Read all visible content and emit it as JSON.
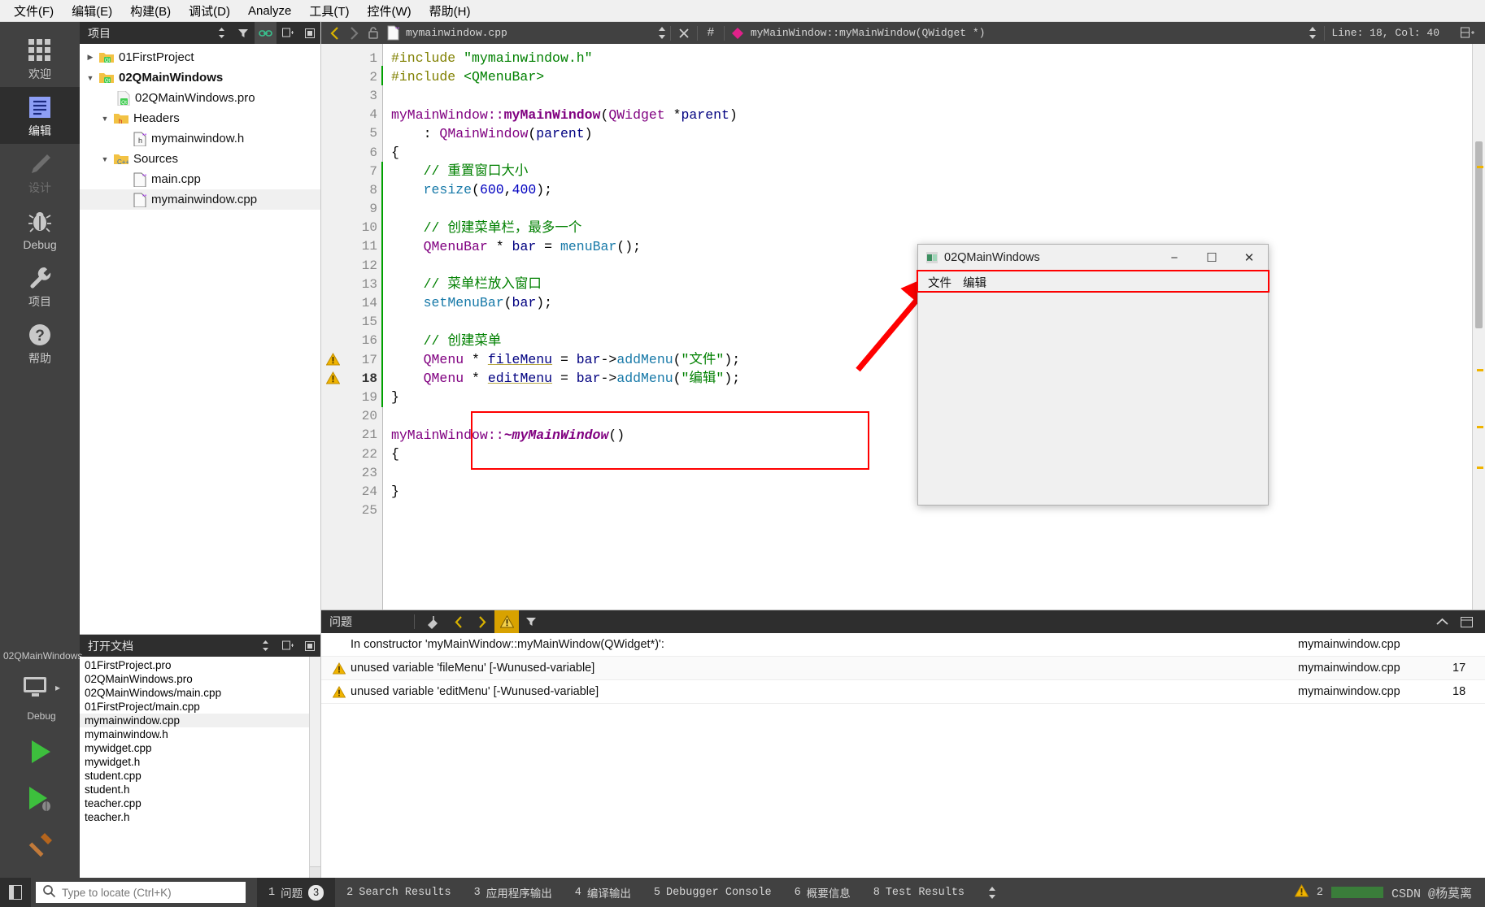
{
  "menubar": [
    {
      "label": "文件(F)",
      "mnemonic": "F"
    },
    {
      "label": "编辑(E)",
      "mnemonic": "E"
    },
    {
      "label": "构建(B)",
      "mnemonic": "B"
    },
    {
      "label": "调试(D)",
      "mnemonic": "D"
    },
    {
      "label": "Analyze",
      "mnemonic": "A"
    },
    {
      "label": "工具(T)",
      "mnemonic": "T"
    },
    {
      "label": "控件(W)",
      "mnemonic": "W"
    },
    {
      "label": "帮助(H)",
      "mnemonic": "H"
    }
  ],
  "modebar": {
    "items": [
      {
        "label": "欢迎",
        "icon": "grid-icon",
        "state": "normal"
      },
      {
        "label": "编辑",
        "icon": "document-lines-icon",
        "state": "active"
      },
      {
        "label": "设计",
        "icon": "pencil-icon",
        "state": "disabled"
      },
      {
        "label": "Debug",
        "icon": "bug-icon",
        "state": "normal"
      },
      {
        "label": "项目",
        "icon": "wrench-icon",
        "state": "normal"
      },
      {
        "label": "帮助",
        "icon": "question-mark-icon",
        "state": "normal"
      }
    ],
    "kit_label": "02QMainWindows",
    "kit_config": "Debug",
    "run_button": "run-icon",
    "debug_button": "run-debug-icon",
    "build_button": "hammer-icon"
  },
  "project_pane": {
    "title": "项目",
    "toolbar": [
      "sort-icon",
      "filter-icon",
      "link-icon",
      "split-icon",
      "close-icon"
    ],
    "tree": [
      {
        "label": "01FirstProject",
        "indent": 0,
        "icon": "qt-folder-icon",
        "expander": "collapsed",
        "bold": false,
        "selected": false
      },
      {
        "label": "02QMainWindows",
        "indent": 0,
        "icon": "qt-folder-icon",
        "expander": "expanded",
        "bold": true,
        "selected": false
      },
      {
        "label": "02QMainWindows.pro",
        "indent": 1,
        "icon": "qt-file-icon",
        "expander": "none",
        "bold": false,
        "selected": false
      },
      {
        "label": "Headers",
        "indent": 1,
        "icon": "h-folder-icon",
        "expander": "expanded",
        "bold": false,
        "selected": false
      },
      {
        "label": "mymainwindow.h",
        "indent": 2,
        "icon": "h-file-icon",
        "expander": "none",
        "bold": false,
        "selected": false
      },
      {
        "label": "Sources",
        "indent": 1,
        "icon": "cpp-folder-icon",
        "expander": "expanded",
        "bold": false,
        "selected": false
      },
      {
        "label": "main.cpp",
        "indent": 2,
        "icon": "cpp-file-icon",
        "expander": "none",
        "bold": false,
        "selected": false
      },
      {
        "label": "mymainwindow.cpp",
        "indent": 2,
        "icon": "cpp-file-icon",
        "expander": "none",
        "bold": false,
        "selected": true
      }
    ]
  },
  "open_documents": {
    "title": "打开文档",
    "toolbar": [
      "sort-icon",
      "split-icon",
      "close-icon"
    ],
    "items": [
      {
        "label": "01FirstProject.pro",
        "selected": false
      },
      {
        "label": "02QMainWindows.pro",
        "selected": false
      },
      {
        "label": "02QMainWindows/main.cpp",
        "selected": false
      },
      {
        "label": "01FirstProject/main.cpp",
        "selected": false
      },
      {
        "label": "mymainwindow.cpp",
        "selected": true
      },
      {
        "label": "mymainwindow.h",
        "selected": false
      },
      {
        "label": "mywidget.cpp",
        "selected": false
      },
      {
        "label": "mywidget.h",
        "selected": false
      },
      {
        "label": "student.cpp",
        "selected": false
      },
      {
        "label": "student.h",
        "selected": false
      },
      {
        "label": "teacher.cpp",
        "selected": false
      },
      {
        "label": "teacher.h",
        "selected": false
      }
    ]
  },
  "editor_toolbar": {
    "split_icon": "split-horizontal-icon",
    "unsplit_icon": "unsplit-icon",
    "back_icon": "back-arrow-icon",
    "forward_icon": "forward-arrow-icon",
    "lock_icon": "unlocked-padlock-icon",
    "file_icon": "cpp-file-icon",
    "filename": "mymainwindow.cpp",
    "close_icon": "close-icon",
    "hash_icon": "hash-icon",
    "symbol_icon": "class-diamond-icon",
    "symbol": "myMainWindow::myMainWindow(QWidget *)",
    "line_col": "Line: 18, Col: 40"
  },
  "code": {
    "filename": "mymainwindow.cpp",
    "first_line": 1,
    "last_line": 25,
    "warning_lines": [
      17,
      18
    ],
    "fold_lines": [
      5,
      21
    ],
    "lines": [
      {
        "n": 1,
        "text": "#include \"mymainwindow.h\""
      },
      {
        "n": 2,
        "text": "#include <QMenuBar>"
      },
      {
        "n": 3,
        "text": ""
      },
      {
        "n": 4,
        "text": "myMainWindow::myMainWindow(QWidget *parent)"
      },
      {
        "n": 5,
        "text": "    : QMainWindow(parent)"
      },
      {
        "n": 6,
        "text": "{"
      },
      {
        "n": 7,
        "text": "    // 重置窗口大小"
      },
      {
        "n": 8,
        "text": "    resize(600,400);"
      },
      {
        "n": 9,
        "text": ""
      },
      {
        "n": 10,
        "text": "    // 创建菜单栏，最多一个"
      },
      {
        "n": 11,
        "text": "    QMenuBar * bar = menuBar();"
      },
      {
        "n": 12,
        "text": ""
      },
      {
        "n": 13,
        "text": "    // 菜单栏放入窗口"
      },
      {
        "n": 14,
        "text": "    setMenuBar(bar);"
      },
      {
        "n": 15,
        "text": ""
      },
      {
        "n": 16,
        "text": "    // 创建菜单"
      },
      {
        "n": 17,
        "text": "    QMenu * fileMenu = bar->addMenu(\"文件\");"
      },
      {
        "n": 18,
        "text": "    QMenu * editMenu = bar->addMenu(\"编辑\");"
      },
      {
        "n": 19,
        "text": "}"
      },
      {
        "n": 20,
        "text": ""
      },
      {
        "n": 21,
        "text": "myMainWindow::~myMainWindow()"
      },
      {
        "n": 22,
        "text": "{"
      },
      {
        "n": 23,
        "text": ""
      },
      {
        "n": 24,
        "text": "}"
      },
      {
        "n": 25,
        "text": ""
      }
    ]
  },
  "app_window": {
    "title": "02QMainWindows",
    "minimize": "−",
    "maximize": "☐",
    "close": "✕",
    "menu_items": [
      "文件",
      "编辑"
    ]
  },
  "issues_panel": {
    "title": "问题",
    "toolbar": [
      "clear-icon",
      "prev-issue-icon",
      "next-issue-icon",
      "warning-filter-icon",
      "filter-icon"
    ],
    "collapse_icon": "chevron-up-icon",
    "maximize_icon": "maximize-pane-icon",
    "rows": [
      {
        "severity": "none",
        "text": "In constructor 'myMainWindow::myMainWindow(QWidget*)':",
        "file": "mymainwindow.cpp",
        "line": ""
      },
      {
        "severity": "warning",
        "text": "unused variable 'fileMenu' [-Wunused-variable]",
        "file": "mymainwindow.cpp",
        "line": "17"
      },
      {
        "severity": "warning",
        "text": "unused variable 'editMenu' [-Wunused-variable]",
        "file": "mymainwindow.cpp",
        "line": "18"
      }
    ]
  },
  "statusbar": {
    "toggle_sidebar_icon": "toggle-sidebar-icon",
    "search_icon": "search-icon",
    "locate_placeholder": "Type to locate (Ctrl+K)",
    "tabs": [
      {
        "num": "1",
        "label": "问题",
        "badge": "3",
        "active": true
      },
      {
        "num": "2",
        "label": "Search Results",
        "badge": "",
        "active": false
      },
      {
        "num": "3",
        "label": "应用程序输出",
        "badge": "",
        "active": false
      },
      {
        "num": "4",
        "label": "编译输出",
        "badge": "",
        "active": false
      },
      {
        "num": "5",
        "label": "Debugger Console",
        "badge": "",
        "active": false
      },
      {
        "num": "6",
        "label": "概要信息",
        "badge": "",
        "active": false
      },
      {
        "num": "8",
        "label": "Test Results",
        "badge": "",
        "active": false
      }
    ],
    "warning_icon": "warning-icon",
    "warning_count": "2",
    "watermark": "CSDN @杨莫离"
  },
  "colors": {
    "accent_dark": "#2e2e2e",
    "toolbar_dark": "#414141",
    "warning_yellow": "#f0b400",
    "annotation_red": "#ff0000",
    "comment_green": "#008000",
    "type_purple": "#800080",
    "function_blue": "#0055aa"
  }
}
